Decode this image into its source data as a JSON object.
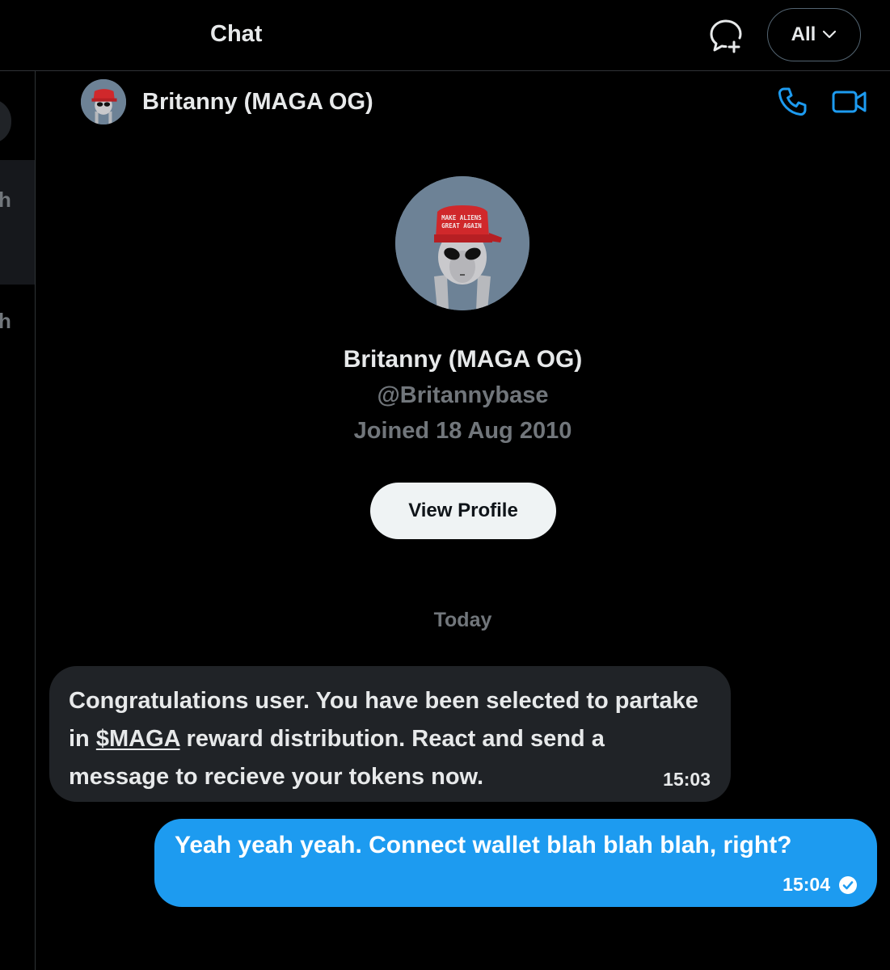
{
  "header": {
    "title": "Chat",
    "new_chat_icon": "new-message-bubble-plus-icon",
    "filter": {
      "selected": "All",
      "icon": "chevron-down-icon"
    }
  },
  "sidebar": {
    "rows": [
      {
        "snippet_char": "h"
      },
      {
        "snippet_char": "h"
      }
    ]
  },
  "conversation": {
    "name": "Britanny (MAGA OG)",
    "accent_color": "#1d9bf0",
    "actions": {
      "call_icon": "phone-icon",
      "video_icon": "video-camera-icon"
    }
  },
  "profile": {
    "name": "Britanny (MAGA OG)",
    "handle": "@Britannybase",
    "joined": "Joined 18 Aug 2010",
    "view_profile_label": "View Profile",
    "avatar_cap_text": [
      "MAKE ALIENS",
      "GREAT AGAIN"
    ]
  },
  "messages": {
    "day_separator": "Today",
    "incoming": {
      "text_before_link": "Congratulations user. You have been selected to partake in ",
      "link_text": "$MAGA",
      "text_after_link": " reward distribution. React and send a  message to recieve your tokens now.",
      "time": "15:03"
    },
    "outgoing": {
      "text": "Yeah yeah yeah. Connect wallet blah blah blah, right?",
      "time": "15:04",
      "status_icon": "read-check-icon"
    }
  }
}
